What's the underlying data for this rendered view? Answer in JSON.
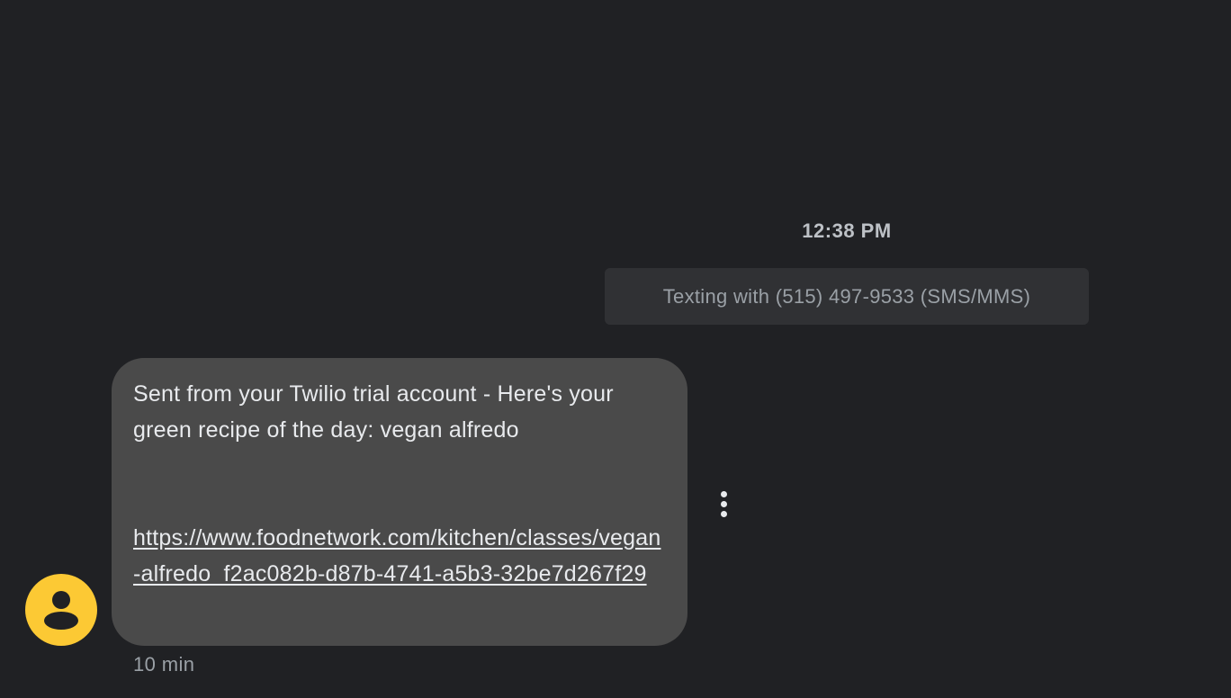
{
  "conversation": {
    "timestamp": "12:38 PM",
    "banner_text": "Texting with (515) 497-9533 (SMS/MMS)"
  },
  "message": {
    "text_line": "Sent from your Twilio trial account - Here's your green recipe of the day: vegan alfredo",
    "link": "https://www.foodnetwork.com/kitchen/classes/vegan-alfredo_f2ac082b-d87b-4741-a5b3-32be7d267f29",
    "age": "10 min",
    "avatar_icon": "person-icon",
    "more_icon": "more-vert-icon"
  },
  "colors": {
    "background": "#202124",
    "banner_bg": "#303134",
    "bubble_bg": "#4a4a4a",
    "avatar_bg": "#fcc934",
    "text_primary": "#e8eaed",
    "text_secondary": "#9aa0a6"
  }
}
